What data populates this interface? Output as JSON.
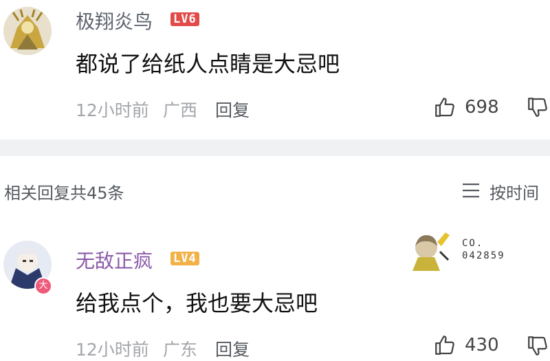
{
  "comments": [
    {
      "username": "极翔炎鸟",
      "level": "LV6",
      "text": "都说了给纸人点睛是大忌吧",
      "time": "12小时前",
      "location": "广西",
      "reply_label": "回复",
      "likes": "698"
    },
    {
      "username": "无敌正疯",
      "level": "LV4",
      "text": "给我点个，我也要大忌吧",
      "time": "12小时前",
      "location": "广东",
      "reply_label": "回复",
      "likes": "430",
      "avatar_badge": "大",
      "pendant_text_1": "CO.",
      "pendant_text_2": "042859"
    }
  ],
  "replies_header": {
    "count_label": "相关回复共45条",
    "sort_label": "按时间"
  },
  "colors": {
    "lv6": "#e34a4a",
    "lv4": "#f2b247",
    "username_vip": "#8a5aa8"
  }
}
